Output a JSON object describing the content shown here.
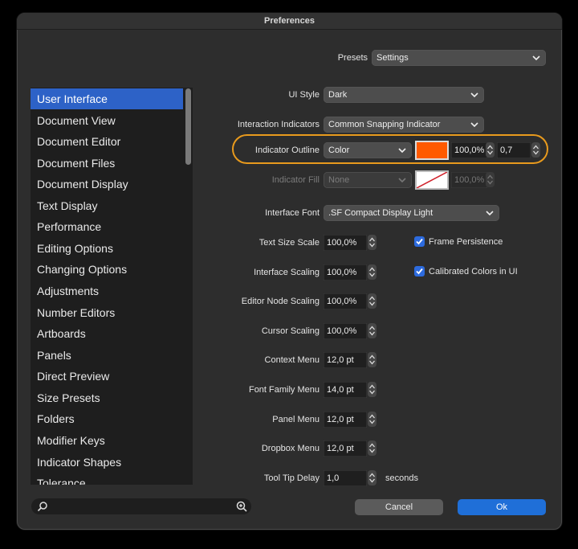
{
  "window": {
    "title": "Preferences"
  },
  "presets": {
    "label": "Presets",
    "value": "Settings"
  },
  "sidebar": {
    "items": [
      {
        "label": "User Interface",
        "selected": true
      },
      {
        "label": "Document View"
      },
      {
        "label": "Document Editor"
      },
      {
        "label": "Document Files"
      },
      {
        "label": "Document Display"
      },
      {
        "label": "Text Display"
      },
      {
        "label": "Performance"
      },
      {
        "label": "Editing Options"
      },
      {
        "label": "Changing Options"
      },
      {
        "label": "Adjustments"
      },
      {
        "label": "Number Editors"
      },
      {
        "label": "Artboards"
      },
      {
        "label": "Panels"
      },
      {
        "label": "Direct Preview"
      },
      {
        "label": "Size Presets"
      },
      {
        "label": "Folders"
      },
      {
        "label": "Modifier Keys"
      },
      {
        "label": "Indicator Shapes"
      },
      {
        "label": "Tolerance"
      }
    ]
  },
  "settings": {
    "ui_style": {
      "label": "UI Style",
      "value": "Dark"
    },
    "interaction_indicators": {
      "label": "Interaction Indicators",
      "value": "Common Snapping Indicator"
    },
    "indicator_outline": {
      "label": "Indicator Outline",
      "mode": "Color",
      "color": "#ff5a00",
      "opacity": "100,0%",
      "width": "0,7"
    },
    "indicator_fill": {
      "label": "Indicator Fill",
      "mode": "None",
      "opacity": "100,0%"
    },
    "interface_font": {
      "label": "Interface Font",
      "value": ".SF Compact Display Light"
    },
    "text_size_scale": {
      "label": "Text Size Scale",
      "value": "100,0%"
    },
    "interface_scaling": {
      "label": "Interface Scaling",
      "value": "100,0%"
    },
    "editor_node_scaling": {
      "label": "Editor Node Scaling",
      "value": "100,0%"
    },
    "cursor_scaling": {
      "label": "Cursor Scaling",
      "value": "100,0%"
    },
    "context_menu": {
      "label": "Context Menu",
      "value": "12,0 pt"
    },
    "font_family_menu": {
      "label": "Font Family Menu",
      "value": "14,0 pt"
    },
    "panel_menu": {
      "label": "Panel Menu",
      "value": "12,0 pt"
    },
    "dropbox_menu": {
      "label": "Dropbox Menu",
      "value": "12,0 pt"
    },
    "tool_tip_delay": {
      "label": "Tool Tip Delay",
      "value": "1,0",
      "unit": "seconds"
    },
    "frame_persistence": {
      "label": "Frame Persistence",
      "checked": true
    },
    "calibrated_colors": {
      "label": "Calibrated Colors in UI",
      "checked": true
    }
  },
  "footer": {
    "cancel": "Cancel",
    "ok": "Ok",
    "search_value": ""
  },
  "colors": {
    "accent": "#2d62c7",
    "highlight": "#e89a1d",
    "outline_color": "#ff5a00"
  }
}
